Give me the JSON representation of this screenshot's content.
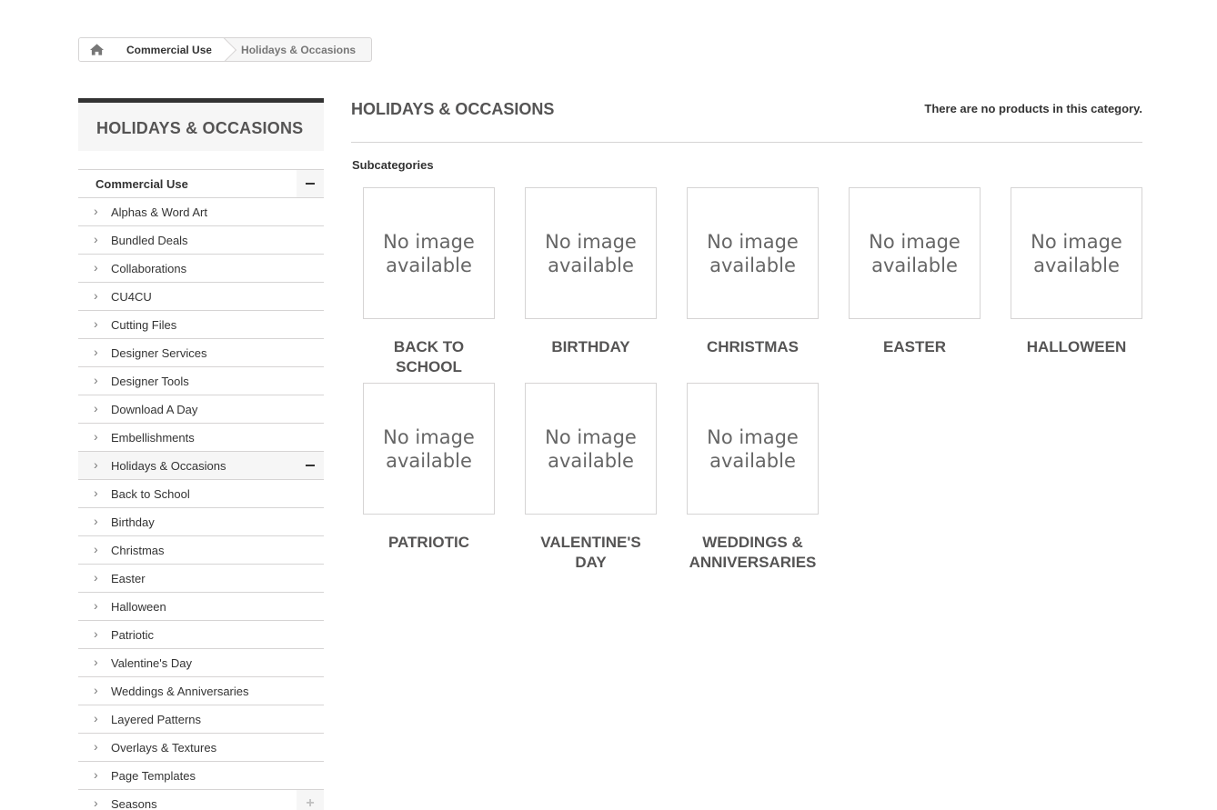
{
  "breadcrumb": {
    "home_icon": "home-icon",
    "parent": "Commercial Use",
    "current": "Holidays & Occasions"
  },
  "sidebar": {
    "title": "HOLIDAYS & OCCASIONS",
    "root": "Commercial Use",
    "items": [
      {
        "label": "Alphas & Word Art"
      },
      {
        "label": "Bundled Deals"
      },
      {
        "label": "Collaborations"
      },
      {
        "label": "CU4CU"
      },
      {
        "label": "Cutting Files"
      },
      {
        "label": "Designer Services"
      },
      {
        "label": "Designer Tools"
      },
      {
        "label": "Download A Day"
      },
      {
        "label": "Embellishments"
      },
      {
        "label": "Holidays & Occasions"
      },
      {
        "label": "Back to School"
      },
      {
        "label": "Birthday"
      },
      {
        "label": "Christmas"
      },
      {
        "label": "Easter"
      },
      {
        "label": "Halloween"
      },
      {
        "label": "Patriotic"
      },
      {
        "label": "Valentine's Day"
      },
      {
        "label": "Weddings & Anniversaries"
      },
      {
        "label": "Layered Patterns"
      },
      {
        "label": "Overlays & Textures"
      },
      {
        "label": "Page Templates"
      },
      {
        "label": "Seasons"
      }
    ]
  },
  "main": {
    "title": "HOLIDAYS & OCCASIONS",
    "no_products": "There are no products in this category.",
    "subcategories_label": "Subcategories",
    "no_image_line1": "No image",
    "no_image_line2": "available",
    "subcategories": [
      {
        "name": "BACK TO SCHOOL"
      },
      {
        "name": "BIRTHDAY"
      },
      {
        "name": "CHRISTMAS"
      },
      {
        "name": "EASTER"
      },
      {
        "name": "HALLOWEEN"
      },
      {
        "name": "PATRIOTIC"
      },
      {
        "name": "VALENTINE'S DAY"
      },
      {
        "name": "WEDDINGS & ANNIVERSARIES"
      }
    ]
  }
}
